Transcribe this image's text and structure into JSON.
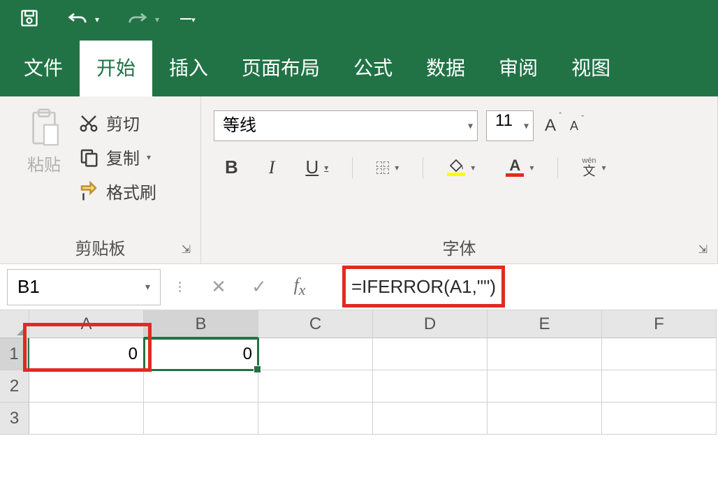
{
  "qat": {
    "save": "save",
    "undo": "undo",
    "redo": "redo"
  },
  "tabs": {
    "file": "文件",
    "home": "开始",
    "insert": "插入",
    "layout": "页面布局",
    "formulas": "公式",
    "data": "数据",
    "review": "审阅",
    "view": "视图"
  },
  "clipboard": {
    "paste": "粘贴",
    "cut": "剪切",
    "copy": "复制",
    "format_painter": "格式刷",
    "group_label": "剪贴板"
  },
  "font": {
    "name": "等线",
    "size": "11",
    "bold": "B",
    "italic": "I",
    "underline": "U",
    "wen_top": "wén",
    "wen_bottom": "文",
    "group_label": "字体"
  },
  "formula_bar": {
    "name_box": "B1",
    "formula": "=IFERROR(A1,\"\")"
  },
  "grid": {
    "cols": [
      "A",
      "B",
      "C",
      "D",
      "E",
      "F"
    ],
    "rows": [
      "1",
      "2",
      "3"
    ],
    "a1": "0",
    "b1": "0"
  }
}
